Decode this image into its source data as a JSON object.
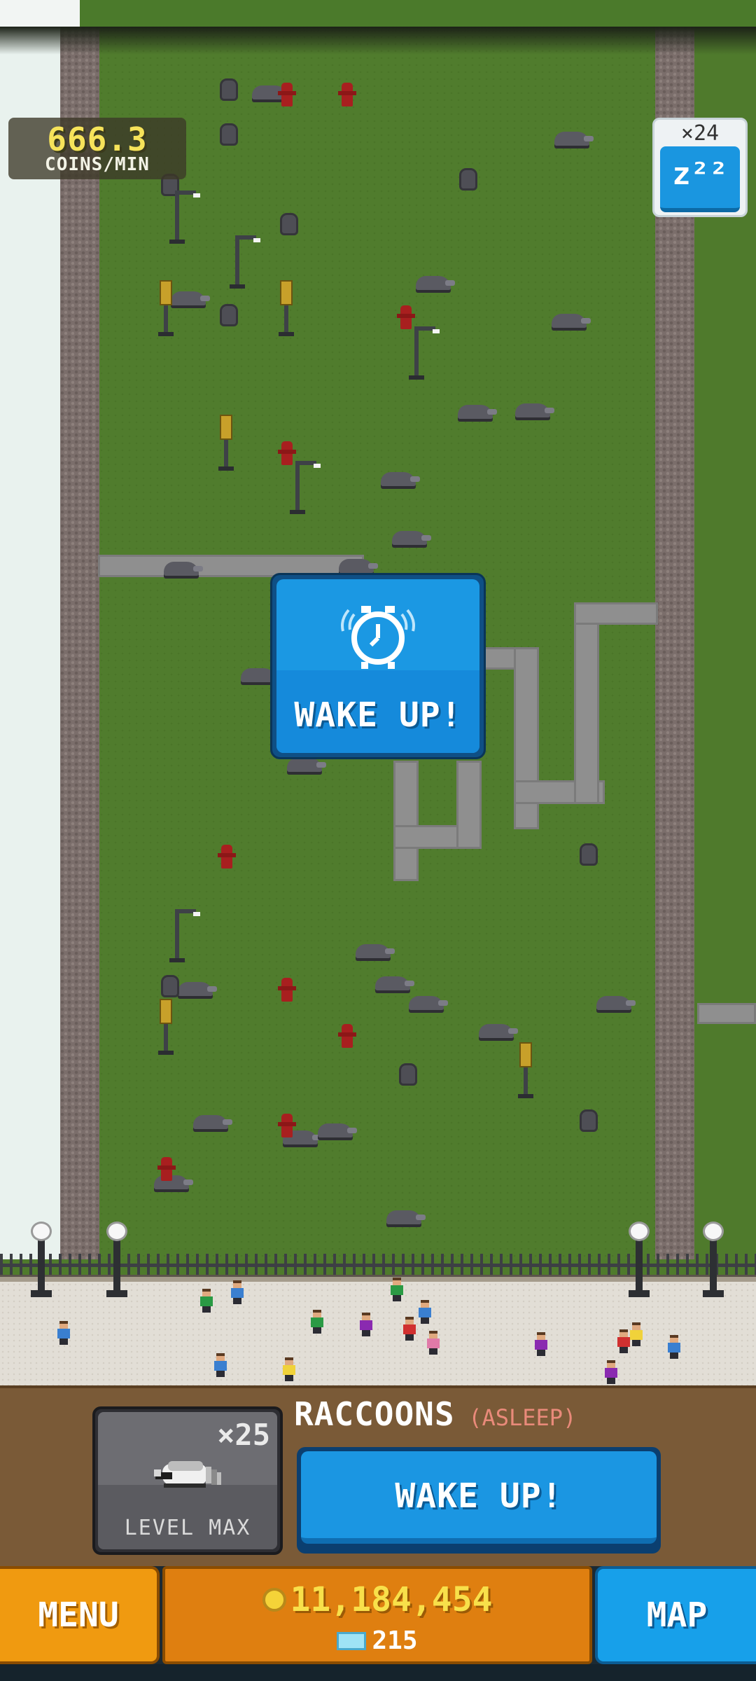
{
  "hud": {
    "coins_per_min_value": "666.3",
    "coins_per_min_label": "COINS/MIN",
    "sleep_count": "×24",
    "sleep_icon": "zzz-icon",
    "sleep_glyph": "z²²"
  },
  "popup": {
    "icon": "alarm-clock-icon",
    "label": "WAKE UP!"
  },
  "animal": {
    "count": "×25",
    "level": "LEVEL MAX",
    "name": "RACCOONS",
    "status": "(ASLEEP)",
    "wake_button": "WAKE UP!"
  },
  "bottom_bar": {
    "menu_label": "MENU",
    "coins": "11,184,454",
    "gems": "215",
    "map_label": "MAP"
  },
  "colors": {
    "grass": "#507c2d",
    "wake_blue": "#1b98e3",
    "menu_orange": "#f09a10",
    "coins_yellow": "#f8e04a",
    "asleep_red": "#e98a7a"
  }
}
